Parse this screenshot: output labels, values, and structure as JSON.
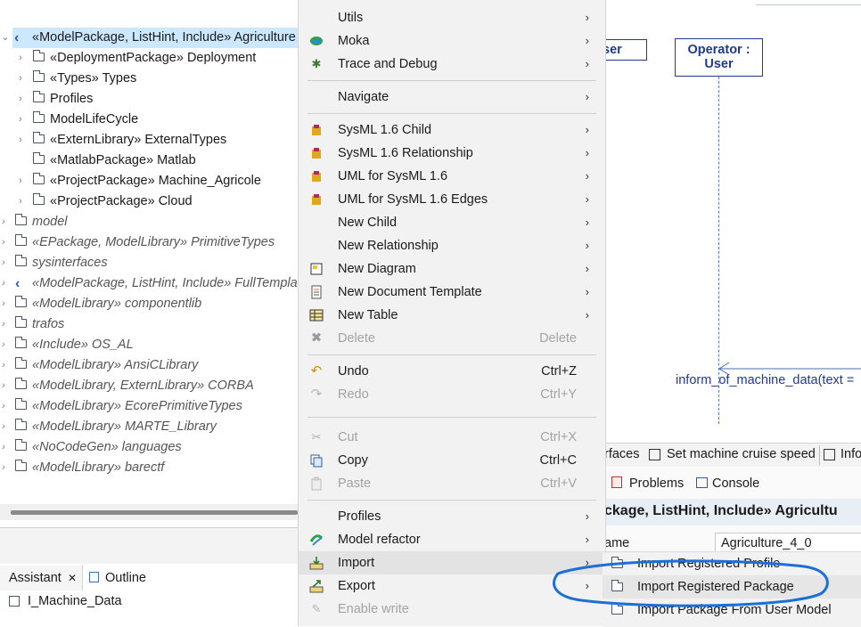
{
  "tree": {
    "root": "«ModelPackage, ListHint, Include» Agriculture",
    "children": [
      "«DeploymentPackage» Deployment",
      "«Types» Types",
      "Profiles",
      "ModelLifeCycle",
      "«ExternLibrary» ExternalTypes",
      "«MatlabPackage» Matlab",
      "«ProjectPackage» Machine_Agricole",
      "«ProjectPackage» Cloud"
    ],
    "imports": [
      "model",
      "«EPackage, ModelLibrary» PrimitiveTypes",
      "sysinterfaces",
      "«ModelPackage, ListHint, Include» FullTemplat",
      "«ModelLibrary» componentlib",
      "trafos",
      "«Include» OS_AL",
      "«ModelLibrary» AnsiCLibrary",
      "«ModelLibrary, ExternLibrary» CORBA",
      "«ModelLibrary» EcorePrimitiveTypes",
      "«ModelLibrary» MARTE_Library",
      "«NoCodeGen» languages",
      "«ModelLibrary» barectf"
    ]
  },
  "bottom_left": {
    "tab_assistant": "Assistant",
    "tab_close": "✕",
    "tab_outline": "Outline",
    "item": "I_Machine_Data"
  },
  "diagram": {
    "lifeline_left": "ser",
    "lifeline_title": "Operator :",
    "lifeline_type": "User",
    "message": "inform_of_machine_data(text ="
  },
  "editor_tabs": {
    "tab1": "rfaces",
    "tab2": "Set machine cruise speed",
    "tab3": "Info"
  },
  "views": {
    "problems": "Problems",
    "console": "Console",
    "prop_title": "ckage, ListHint, Include» Agricultu",
    "prop_label": "ame",
    "prop_value": "Agriculture_4_0"
  },
  "menu": {
    "utils": "Utils",
    "moka": "Moka",
    "trace": "Trace and Debug",
    "navigate": "Navigate",
    "sysml_child": "SysML 1.6 Child",
    "sysml_rel": "SysML 1.6 Relationship",
    "uml_sysml": "UML for SysML 1.6",
    "uml_sysml_edges": "UML for SysML 1.6 Edges",
    "new_child": "New Child",
    "new_rel": "New Relationship",
    "new_diagram": "New Diagram",
    "new_doc": "New Document Template",
    "new_table": "New Table",
    "delete": "Delete",
    "delete_sc": "Delete",
    "undo": "Undo",
    "undo_sc": "Ctrl+Z",
    "redo": "Redo",
    "redo_sc": "Ctrl+Y",
    "cut": "Cut",
    "cut_sc": "Ctrl+X",
    "copy": "Copy",
    "copy_sc": "Ctrl+C",
    "paste": "Paste",
    "paste_sc": "Ctrl+V",
    "profiles": "Profiles",
    "refactor": "Model refactor",
    "import": "Import",
    "export": "Export",
    "enable_write": "Enable write"
  },
  "submenu": {
    "profile": "Import Registered Profile",
    "package": "Import Registered Package",
    "user_model": "Import Package From User Model"
  },
  "colors": {
    "selection": "#cce8ff",
    "diagram_blue": "#1f3b8c",
    "annotation": "#1a6fd8"
  }
}
